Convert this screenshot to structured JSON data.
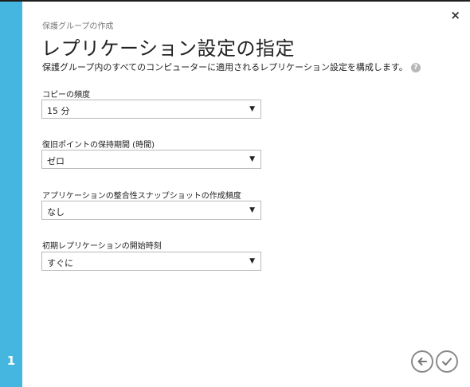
{
  "wizard": {
    "breadcrumb": "保護グループの作成",
    "title": "レプリケーション設定の指定",
    "subtitle": "保護グループ内のすべてのコンピューターに適用されるレプリケーション設定を構成します。",
    "help_glyph": "?",
    "close_glyph": "×",
    "step_number": "1"
  },
  "fields": [
    {
      "label": "コピーの頻度",
      "value": "15 分"
    },
    {
      "label": "復旧ポイントの保持期間 (時間)",
      "value": "ゼロ"
    },
    {
      "label": "アプリケーションの整合性スナップショットの作成頻度",
      "value": "なし"
    },
    {
      "label": "初期レプリケーションの開始時刻",
      "value": "すぐに"
    }
  ],
  "dropdown_arrow": "▼",
  "nav": {
    "back_icon": "arrow-left-icon",
    "finish_icon": "checkmark-icon"
  },
  "colors": {
    "step_bar": "#44b6e0",
    "top_bar": "#1e1e1e"
  }
}
